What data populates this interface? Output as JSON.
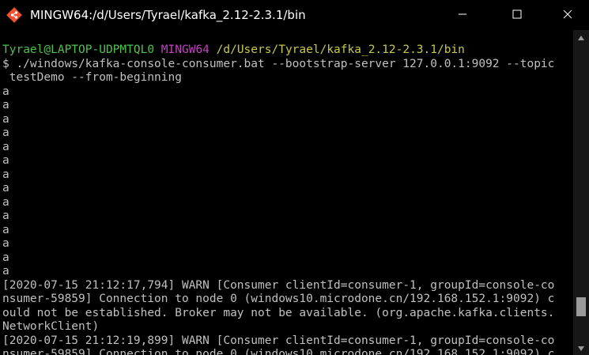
{
  "window": {
    "title": "MINGW64:/d/Users/Tyrael/kafka_2.12-2.3.1/bin",
    "icon": "git-bash-icon",
    "controls": [
      "minimize-icon",
      "maximize-icon",
      "close-icon"
    ]
  },
  "colors": {
    "background": "#000000",
    "text": "#c0c0c0",
    "prompt_user": "#4ec24e",
    "prompt_env": "#c040c0",
    "prompt_path": "#c8c84a",
    "scrollbar_track": "#171717",
    "scrollbar_thumb": "#9a9a9a"
  },
  "prompt": {
    "user_host": "Tyrael@LAPTOP-UDPMTQL0",
    "env": "MINGW64",
    "path": "/d/Users/Tyrael/kafka_2.12-2.3.1/bin"
  },
  "command": {
    "line1": "$ ./windows/kafka-console-consumer.bat --bootstrap-server 127.0.0.1:9092 --topic",
    "line2": " testDemo --from-beginning"
  },
  "messages": [
    "a",
    "a",
    "a",
    "a",
    "a",
    "a",
    "a",
    "a",
    "a",
    "a",
    "a",
    "a",
    "a",
    "a"
  ],
  "log_lines": [
    "[2020-07-15 21:12:17,794] WARN [Consumer clientId=consumer-1, groupId=console-co",
    "nsumer-59859] Connection to node 0 (windows10.microdone.cn/192.168.152.1:9092) c",
    "ould not be established. Broker may not be available. (org.apache.kafka.clients.",
    "NetworkClient)",
    "[2020-07-15 21:12:19,899] WARN [Consumer clientId=consumer-1, groupId=console-co",
    "nsumer-59859] Connection to node 0 (windows10.microdone.cn/192.168.152.1:9092) c"
  ]
}
